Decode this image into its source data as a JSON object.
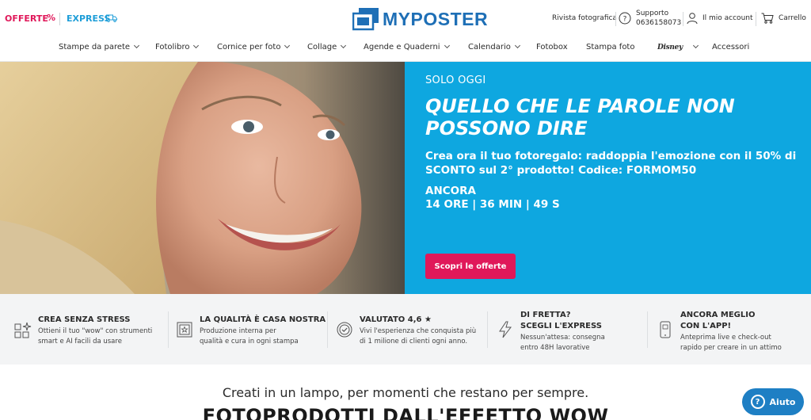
{
  "topbar": {
    "offerte": "OFFERTE",
    "offerte_icon": "%",
    "express": "EXPRESS",
    "logo_text": "MYPOSTER",
    "rivista": "Rivista fotografica",
    "support_label": "Supporto",
    "support_phone": "0636158073",
    "account": "Il mio account",
    "cart": "Carrello"
  },
  "nav": {
    "items": [
      {
        "label": "Stampe da parete"
      },
      {
        "label": "Fotolibro"
      },
      {
        "label": "Cornice per foto"
      },
      {
        "label": "Collage"
      },
      {
        "label": "Agende e Quaderni"
      },
      {
        "label": "Calendario"
      },
      {
        "label": "Fotobox"
      },
      {
        "label": "Stampa foto"
      },
      {
        "label": "Disney"
      },
      {
        "label": "Accessori"
      }
    ]
  },
  "hero": {
    "eyebrow": "SOLO OGGI",
    "headline": "QUELLO CHE LE PAROLE NON POSSONO DIRE",
    "subline": "Crea ora il tuo fotoregalo: raddoppia l'emozione con il 50% di SCONTO sul 2° prodotto! Codice: FORMOM50",
    "countdown_label": "ANCORA",
    "countdown_value": "14 ORE | 36 MIN | 49 S",
    "cta": "Scopri le offerte"
  },
  "features": [
    {
      "title": "CREA SENZA STRESS",
      "desc1": "Ottieni il tuo \"wow\" con strumenti",
      "desc2": "smart e AI facili da usare",
      "icon": "sparkle-grid-icon"
    },
    {
      "title": "LA QUALITÀ È CASA NOSTRA",
      "desc1": "Produzione interna per",
      "desc2": "qualità e cura in ogni stampa",
      "icon": "star-frame-icon"
    },
    {
      "title": "VALUTATO 4,6 ★",
      "desc1": "Vivi l'esperienza che conquista più",
      "desc2": "di 1 milione di clienti ogni anno.",
      "icon": "check-badge-icon"
    },
    {
      "title": "DI FRETTA?",
      "title2": "SCEGLI L'EXPRESS",
      "desc1": "Nessun'attesa: consegna",
      "desc2": "entro 48H lavorative",
      "icon": "lightning-icon"
    },
    {
      "title": "ANCORA MEGLIO",
      "title2": "CON L'APP!",
      "desc1": "Anteprima live e check-out",
      "desc2": "rapido per creare in un attimo",
      "icon": "phone-app-icon"
    }
  ],
  "bottom": {
    "tagline": "Creati in un lampo, per momenti che restano per sempre.",
    "title": "FOTOPRODOTTI DALL'EFFETTO WOW"
  },
  "help": {
    "label": "Aiuto",
    "icon_glyph": "?"
  },
  "colors": {
    "brand_blue": "#1e6fb6",
    "hero_blue": "#0ea7e0",
    "accent_pink": "#e0185a",
    "express_blue": "#1e9ed8"
  }
}
